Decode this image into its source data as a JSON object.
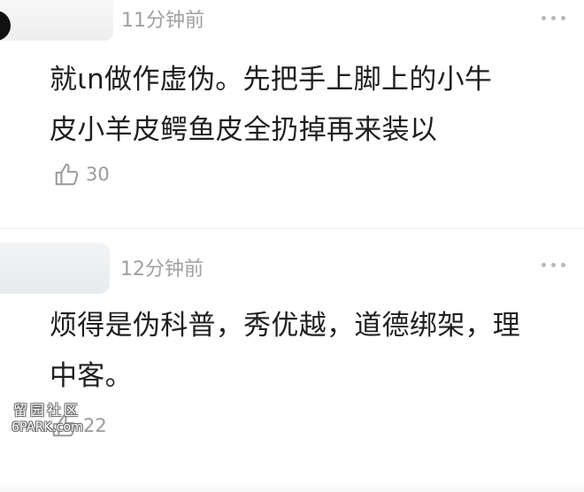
{
  "comments": [
    {
      "time": "11分钟前",
      "lines": [
        "就ιn做作虚伪。先把手上脚上的小牛",
        "皮小羊皮鳄鱼皮全扔掉再来装以"
      ],
      "likes": "30"
    },
    {
      "time": "12分钟前",
      "lines": [
        "烦得是伪科普，秀优越，道德绑架，理",
        "中客。"
      ],
      "likes": "22"
    }
  ],
  "watermark": {
    "chinese": "留园社区",
    "english": "6PARK.com"
  },
  "icons": {
    "more": "more-dots-icon",
    "like": "thumbs-up-icon"
  },
  "colors": {
    "text": "#1f1f1f",
    "meta": "#a0a0a0",
    "icon": "#9b9b9b",
    "divider": "#ececec"
  }
}
